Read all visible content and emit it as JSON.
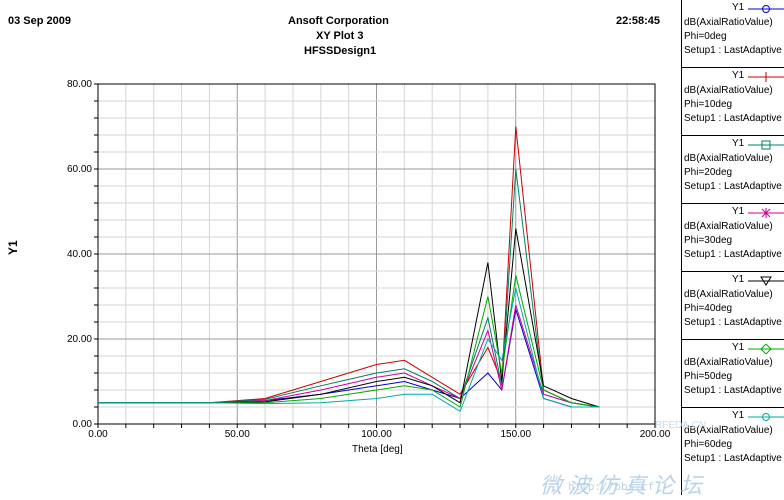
{
  "header": {
    "date": "03 Sep 2009",
    "company": "Ansoft Corporation",
    "plot_name": "XY Plot 3",
    "design": "HFSSDesign1",
    "time": "22:58:45"
  },
  "watermark": {
    "text": "微波仿真论坛",
    "url": "http://bbs.rf",
    "site": "RFEDA.CN"
  },
  "legend": [
    {
      "y": "Y1",
      "expr": "dB(AxialRatioValue)",
      "phi": "Phi=0deg",
      "setup": "Setup1 : LastAdaptive",
      "color": "#0000cc",
      "marker": "circle"
    },
    {
      "y": "Y1",
      "expr": "dB(AxialRatioValue)",
      "phi": "Phi=10deg",
      "setup": "Setup1 : LastAdaptive",
      "color": "#cc0000",
      "marker": "plus"
    },
    {
      "y": "Y1",
      "expr": "dB(AxialRatioValue)",
      "phi": "Phi=20deg",
      "setup": "Setup1 : LastAdaptive",
      "color": "#008060",
      "marker": "square"
    },
    {
      "y": "Y1",
      "expr": "dB(AxialRatioValue)",
      "phi": "Phi=30deg",
      "setup": "Setup1 : LastAdaptive",
      "color": "#cc0099",
      "marker": "star"
    },
    {
      "y": "Y1",
      "expr": "dB(AxialRatioValue)",
      "phi": "Phi=40deg",
      "setup": "Setup1 : LastAdaptive",
      "color": "#000000",
      "marker": "triangle-down"
    },
    {
      "y": "Y1",
      "expr": "dB(AxialRatioValue)",
      "phi": "Phi=50deg",
      "setup": "Setup1 : LastAdaptive",
      "color": "#00aa00",
      "marker": "diamond"
    },
    {
      "y": "Y1",
      "expr": "dB(AxialRatioValue)",
      "phi": "Phi=60deg",
      "setup": "Setup1 : LastAdaptive",
      "color": "#00aaaa",
      "marker": "circle"
    }
  ],
  "chart_data": {
    "type": "line",
    "xlabel": "Theta [deg]",
    "ylabel": "Y1",
    "xlim": [
      0,
      200
    ],
    "ylim": [
      0,
      80
    ],
    "x_ticks": [
      "0.00",
      "50.00",
      "100.00",
      "150.00",
      "200.00"
    ],
    "y_ticks": [
      "0.00",
      "20.00",
      "40.00",
      "60.00",
      "80.00"
    ],
    "grid": true,
    "legend_position": "right",
    "x": [
      0,
      20,
      40,
      60,
      80,
      100,
      110,
      120,
      130,
      140,
      145,
      150,
      160,
      170,
      180
    ],
    "series": [
      {
        "name": "Phi=0deg",
        "color": "#0000cc",
        "values": [
          5,
          5,
          5,
          5.5,
          7,
          9,
          10,
          8,
          6,
          12,
          8,
          27,
          6,
          4,
          4
        ]
      },
      {
        "name": "Phi=10deg",
        "color": "#cc0000",
        "values": [
          5,
          5,
          5,
          6,
          10,
          14,
          15,
          11,
          7,
          18,
          10,
          70,
          8,
          5,
          4
        ]
      },
      {
        "name": "Phi=20deg",
        "color": "#008060",
        "values": [
          5,
          5,
          5,
          5.8,
          9,
          12,
          13,
          10,
          6,
          25,
          9,
          60,
          7,
          5,
          4
        ]
      },
      {
        "name": "Phi=30deg",
        "color": "#cc0099",
        "values": [
          5,
          5,
          5,
          5.5,
          8,
          11,
          12,
          9,
          6,
          22,
          8,
          28,
          7,
          5,
          4
        ]
      },
      {
        "name": "Phi=40deg",
        "color": "#000000",
        "values": [
          5,
          5,
          5,
          5.2,
          7,
          10,
          11,
          9,
          5,
          38,
          10,
          46,
          9,
          6,
          4
        ]
      },
      {
        "name": "Phi=50deg",
        "color": "#00aa00",
        "values": [
          5,
          5,
          5,
          5,
          6,
          8,
          9,
          8,
          4,
          30,
          12,
          35,
          8,
          5,
          4
        ]
      },
      {
        "name": "Phi=60deg",
        "color": "#00aaaa",
        "values": [
          5,
          5,
          5,
          4.8,
          5,
          6,
          7,
          7,
          3,
          20,
          15,
          32,
          6,
          4,
          4
        ]
      }
    ]
  }
}
